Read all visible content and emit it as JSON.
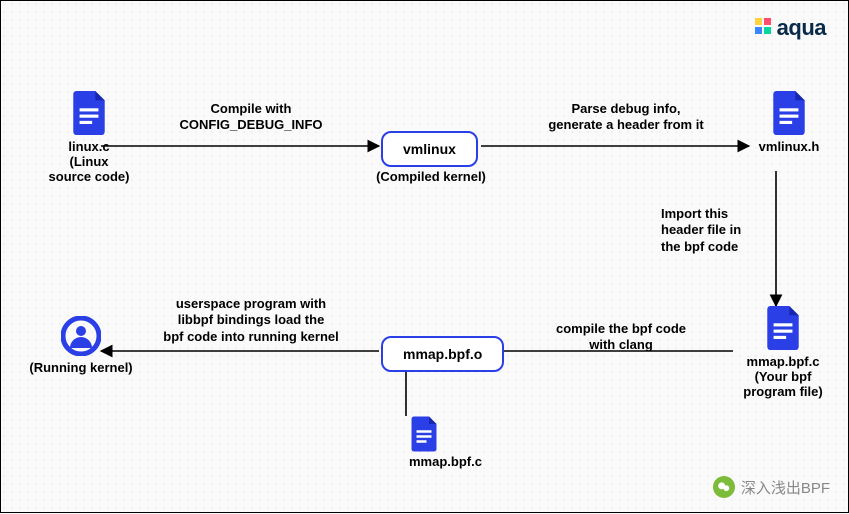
{
  "brand": {
    "name": "aqua"
  },
  "nodes": {
    "linux_c": {
      "title": "linux.c",
      "caption": "(Linux\nsource code)"
    },
    "vmlinux": {
      "title": "vmlinux",
      "caption": "(Compiled kernel)"
    },
    "vmlinux_h": {
      "title": "vmlinux.h"
    },
    "mmap_bpf_c": {
      "title": "mmap.bpf.c",
      "caption": "(Your bpf\nprogram file)"
    },
    "mmap_bpf_o": {
      "title": "mmap.bpf.o"
    },
    "mmap_bpf_c2": {
      "title": "mmap.bpf.c"
    },
    "running_kernel": {
      "title": "(Running kernel)"
    }
  },
  "edges": {
    "compile": "Compile with\nCONFIG_DEBUG_INFO",
    "parse": "Parse debug info,\ngenerate a header from it",
    "import": "Import this\nheader file in\nthe bpf code",
    "clang": "compile the bpf code\nwith clang",
    "load": "userspace program with\nlibbpf bindings load the\nbpf code into running kernel"
  },
  "footer": {
    "text": "深入浅出BPF"
  }
}
